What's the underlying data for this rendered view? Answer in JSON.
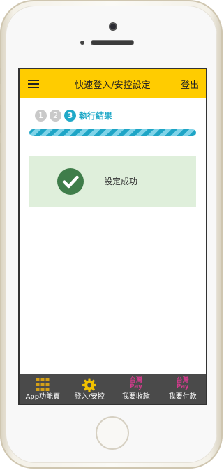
{
  "header": {
    "title": "快速登入/安控設定",
    "logout_label": "登出"
  },
  "steps": {
    "items": [
      "1",
      "2",
      "3"
    ],
    "active_index": 3,
    "active_label": "執行結果"
  },
  "result": {
    "message": "設定成功"
  },
  "tabbar": {
    "items": [
      {
        "label": "App功能頁",
        "icon": "grid-icon"
      },
      {
        "label": "登入/安控",
        "icon": "gear-icon"
      },
      {
        "label": "我要收款",
        "icon": "taiwan-pay-icon",
        "icon_text": [
          "台灣",
          "Pay"
        ]
      },
      {
        "label": "我要付款",
        "icon": "taiwan-pay-icon",
        "icon_text": [
          "台灣",
          "Pay"
        ]
      }
    ]
  },
  "colors": {
    "header": "#ffcc00",
    "accent": "#21a9c8",
    "success_bg": "#dfefdb",
    "success_icon": "#3f7d4a",
    "tabbar": "#4a4a4a",
    "gear": "#f2c200",
    "pay": "#d23b8c"
  }
}
